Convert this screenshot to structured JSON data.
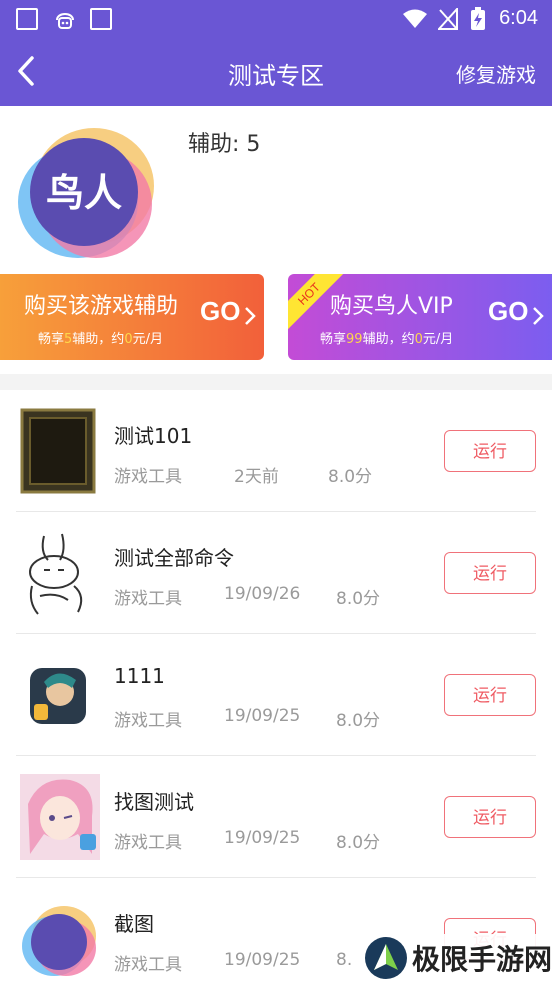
{
  "statusbar": {
    "time": "6:04"
  },
  "header": {
    "title": "测试专区",
    "repair_label": "修复游戏"
  },
  "game": {
    "logo_text": "鸟人",
    "aux_text": "辅助: 5"
  },
  "banners": [
    {
      "title": "购买该游戏辅助",
      "sub_pre": "畅享",
      "sub_hl1": "5",
      "sub_mid": "辅助，约",
      "sub_hl2": "0",
      "sub_post": "元/月",
      "go": "GO"
    },
    {
      "hot": "HOT",
      "title": "购买鸟人VIP",
      "sub_pre": "畅享",
      "sub_hl1": "99",
      "sub_mid": "辅助，约",
      "sub_hl2": "0",
      "sub_post": "元/月",
      "go": "GO"
    }
  ],
  "run_label": "运行",
  "items": [
    {
      "name": "测试101",
      "category": "游戏工具",
      "date": "2天前",
      "score": "8.0分"
    },
    {
      "name": "测试全部命令",
      "category": "游戏工具",
      "date": "19/09/26",
      "score": "8.0分"
    },
    {
      "name": "1111",
      "category": "游戏工具",
      "date": "19/09/25",
      "score": "8.0分"
    },
    {
      "name": "找图测试",
      "category": "游戏工具",
      "date": "19/09/25",
      "score": "8.0分"
    },
    {
      "name": "截图",
      "category": "游戏工具",
      "date": "19/09/25",
      "score": "8."
    }
  ],
  "watermark": {
    "text": "极限手游网"
  },
  "colors": {
    "primary": "#6a56d4",
    "run_border": "#f0727a",
    "banner1": "#f2603a",
    "banner2": "#7a5ef0"
  }
}
